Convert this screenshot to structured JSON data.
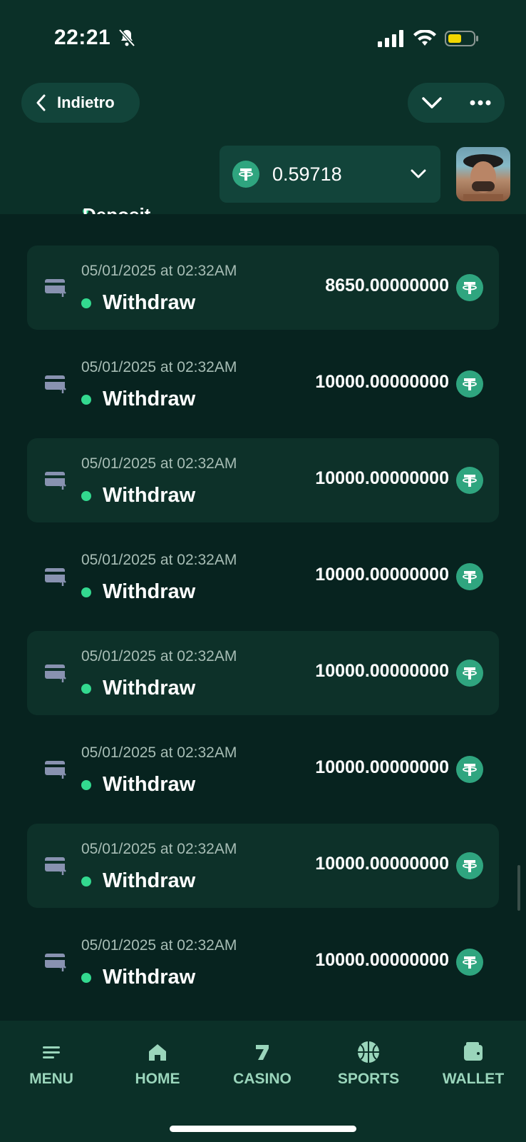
{
  "status_bar": {
    "time": "22:21"
  },
  "nav": {
    "back_label": "Indietro"
  },
  "balance": {
    "amount": "0.59718",
    "currency_icon": "tether-icon"
  },
  "partial_item": {
    "type": "Deposit"
  },
  "transactions": [
    {
      "date": "05/01/2025 at 02:32AM",
      "type": "Withdraw",
      "amount": "8650.00000000"
    },
    {
      "date": "05/01/2025 at 02:32AM",
      "type": "Withdraw",
      "amount": "10000.00000000"
    },
    {
      "date": "05/01/2025 at 02:32AM",
      "type": "Withdraw",
      "amount": "10000.00000000"
    },
    {
      "date": "05/01/2025 at 02:32AM",
      "type": "Withdraw",
      "amount": "10000.00000000"
    },
    {
      "date": "05/01/2025 at 02:32AM",
      "type": "Withdraw",
      "amount": "10000.00000000"
    },
    {
      "date": "05/01/2025 at 02:32AM",
      "type": "Withdraw",
      "amount": "10000.00000000"
    },
    {
      "date": "05/01/2025 at 02:32AM",
      "type": "Withdraw",
      "amount": "10000.00000000"
    },
    {
      "date": "05/01/2025 at 02:32AM",
      "type": "Withdraw",
      "amount": "10000.00000000"
    }
  ],
  "tabs": [
    {
      "label": "MENU",
      "icon": "menu-icon"
    },
    {
      "label": "HOME",
      "icon": "home-icon"
    },
    {
      "label": "CASINO",
      "icon": "casino-icon"
    },
    {
      "label": "SPORTS",
      "icon": "sports-icon"
    },
    {
      "label": "WALLET",
      "icon": "wallet-icon"
    }
  ],
  "colors": {
    "background": "#07231f",
    "header": "#0b3028",
    "row_alt": "#0d3129",
    "status_dot": "#33d98f",
    "coin": "#2fa57f",
    "tab_label": "#9ad5bb",
    "battery": "#f2d600"
  }
}
